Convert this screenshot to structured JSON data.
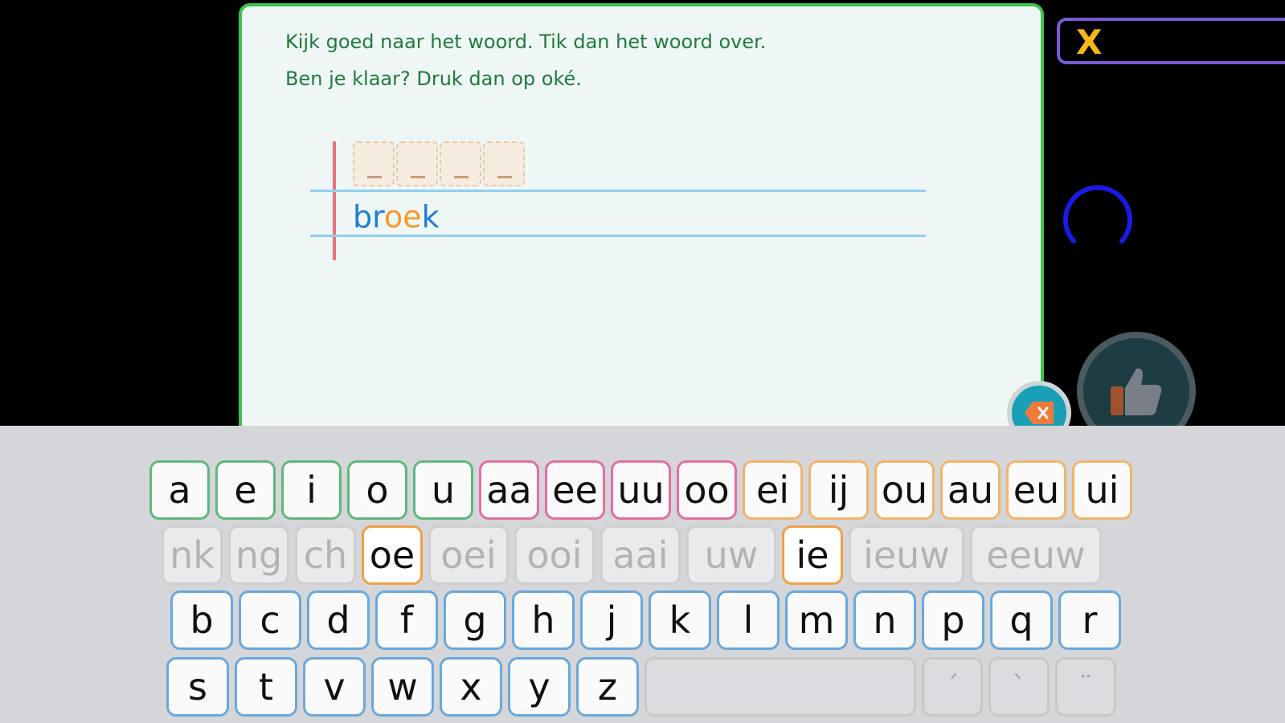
{
  "instructions": {
    "line1": "Kijk goed naar het woord. Tik dan het woord over.",
    "line2": "Ben je klaar? Druk dan op oké."
  },
  "exercise": {
    "slot_placeholder": "_",
    "word_parts": [
      {
        "text": "br",
        "color": "#1f7fd1"
      },
      {
        "text": "oe",
        "color": "#f59a2b"
      },
      {
        "text": "k",
        "color": "#1f7fd1"
      }
    ]
  },
  "close": {
    "label": "X"
  },
  "keyboard": {
    "row1": [
      "a",
      "e",
      "i",
      "o",
      "u",
      "aa",
      "ee",
      "uu",
      "oo",
      "ei",
      "ij",
      "ou",
      "au",
      "eu",
      "ui"
    ],
    "row2": [
      "nk",
      "ng",
      "ch",
      "oe",
      "oei",
      "ooi",
      "aai",
      "uw",
      "ie",
      "ieuw",
      "eeuw"
    ],
    "row3": [
      "b",
      "c",
      "d",
      "f",
      "g",
      "h",
      "j",
      "k",
      "l",
      "m",
      "n",
      "p",
      "q",
      "r"
    ],
    "row4": [
      "s",
      "t",
      "v",
      "w",
      "x",
      "y",
      "z"
    ],
    "accents": [
      "´",
      "`",
      "¨"
    ]
  },
  "colors": {
    "card_border": "#3cc24a",
    "instruction_text": "#1f7a3c",
    "close_accent": "#f7b718",
    "spinner": "#1a1ae6",
    "delete_button": "#1aa0b6"
  }
}
